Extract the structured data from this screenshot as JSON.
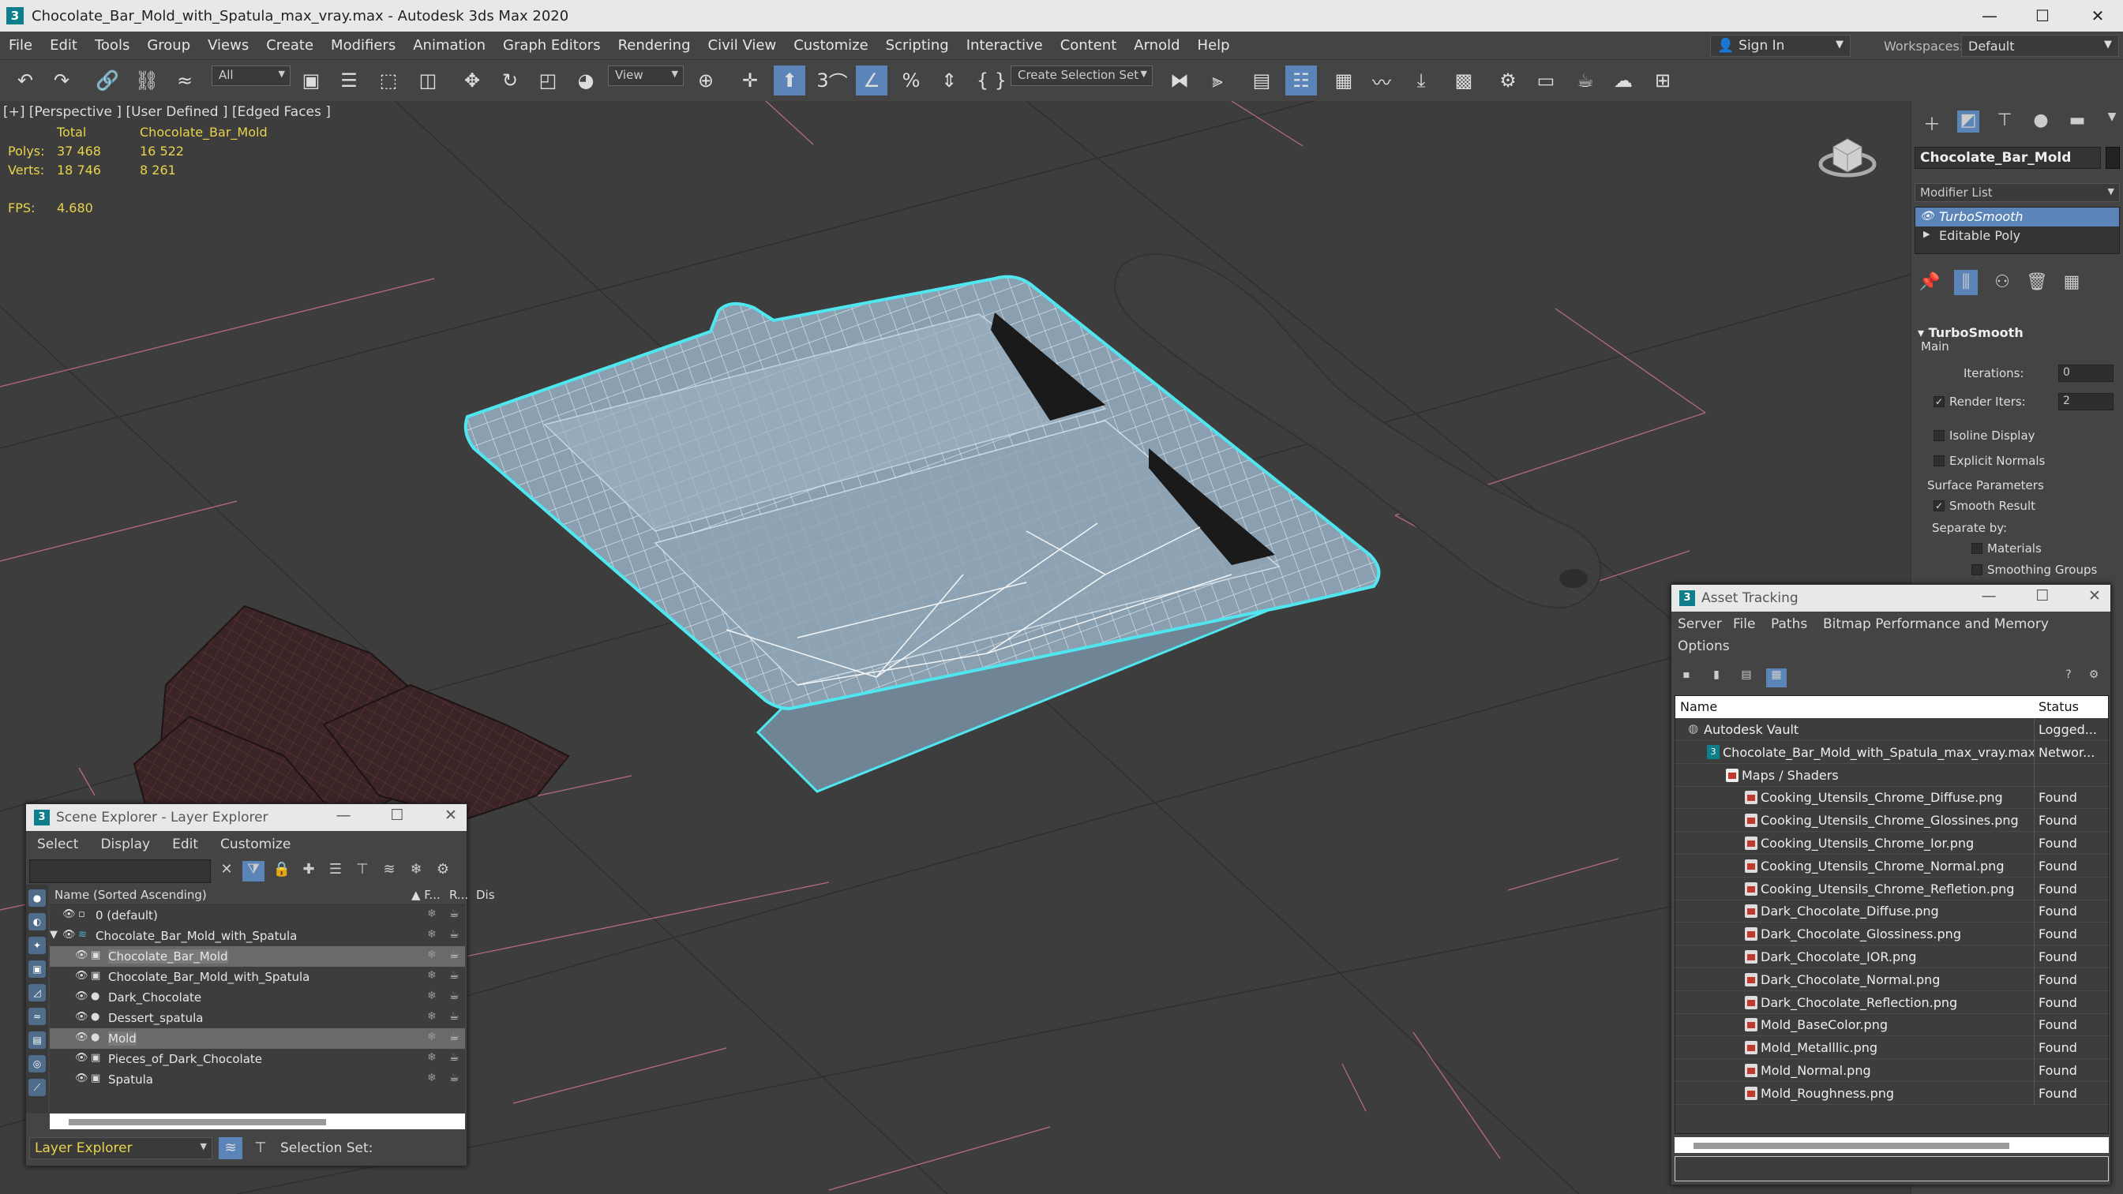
{
  "window": {
    "title": "Chocolate_Bar_Mold_with_Spatula_max_vray.max - Autodesk 3ds Max 2020",
    "app_icon_letter": "3"
  },
  "menubar": {
    "items": [
      "File",
      "Edit",
      "Tools",
      "Group",
      "Views",
      "Create",
      "Modifiers",
      "Animation",
      "Graph Editors",
      "Rendering",
      "Civil View",
      "Customize",
      "Scripting",
      "Interactive",
      "Content",
      "Arnold",
      "Help"
    ],
    "sign_in": "Sign In",
    "workspaces_label": "Workspaces:",
    "workspace_value": "Default"
  },
  "toolbar": {
    "filter_value": "All",
    "coord_value": "View",
    "selection_set": "Create Selection Set",
    "snap_label": "3",
    "accent_color": "#5b84b8"
  },
  "viewport": {
    "label": "[+] [Perspective ] [User Defined ] [Edged Faces ]",
    "stats": {
      "total_label": "Total",
      "object_label": "Chocolate_Bar_Mold",
      "polys_label": "Polys:",
      "polys_total": "37 468",
      "polys_object": "16 522",
      "verts_label": "Verts:",
      "verts_total": "18 746",
      "verts_object": "8 261",
      "fps_label": "FPS:",
      "fps_value": "4.680"
    },
    "selection_color": "#4fe6f0",
    "stat_color": "#e8d34a"
  },
  "command_panel": {
    "object_name": "Chocolate_Bar_Mold",
    "modifier_list": "Modifier List",
    "stack": [
      "TurboSmooth",
      "Editable Poly"
    ],
    "turbosmooth": {
      "header": "TurboSmooth",
      "main_label": "Main",
      "iterations_label": "Iterations:",
      "iterations_value": "0",
      "render_iters_label": "Render Iters:",
      "render_iters_value": "2",
      "render_iters_checked": true,
      "isoline_label": "Isoline Display",
      "explicit_normals_label": "Explicit Normals",
      "surface_params_label": "Surface Parameters",
      "smooth_result_label": "Smooth Result",
      "smooth_result_checked": true,
      "separate_by_label": "Separate by:",
      "materials_label": "Materials",
      "smoothing_groups_label": "Smoothing Groups"
    }
  },
  "scene_explorer": {
    "title": "Scene Explorer - Layer Explorer",
    "menu": [
      "Select",
      "Display",
      "Edit",
      "Customize"
    ],
    "columns": {
      "name": "Name (Sorted Ascending)",
      "frozen": "▲ F...",
      "render": "R...",
      "display": "Dis"
    },
    "rows": [
      {
        "label": "0 (default)",
        "indent": 0,
        "type": "layer",
        "selected": false
      },
      {
        "label": "Chocolate_Bar_Mold_with_Spatula",
        "indent": 0,
        "type": "layer-open",
        "selected": false
      },
      {
        "label": "Chocolate_Bar_Mold",
        "indent": 1,
        "type": "object",
        "selected": true
      },
      {
        "label": "Chocolate_Bar_Mold_with_Spatula",
        "indent": 1,
        "type": "object",
        "selected": false
      },
      {
        "label": "Dark_Chocolate",
        "indent": 1,
        "type": "sphere",
        "selected": false
      },
      {
        "label": "Dessert_spatula",
        "indent": 1,
        "type": "sphere",
        "selected": false
      },
      {
        "label": "Mold",
        "indent": 1,
        "type": "sphere",
        "selected": true
      },
      {
        "label": "Pieces_of_Dark_Chocolate",
        "indent": 1,
        "type": "object",
        "selected": false
      },
      {
        "label": "Spatula",
        "indent": 1,
        "type": "object",
        "selected": false
      }
    ],
    "layer_dropdown": "Layer Explorer",
    "selection_set_label": "Selection Set:"
  },
  "asset_tracking": {
    "title": "Asset Tracking",
    "menu": [
      "Server",
      "File",
      "Paths",
      "Bitmap Performance and Memory",
      "Options"
    ],
    "columns": {
      "name": "Name",
      "status": "Status"
    },
    "rows": [
      {
        "name": "Autodesk Vault",
        "status": "Logged...",
        "indent": 0,
        "icon": "vault"
      },
      {
        "name": "Chocolate_Bar_Mold_with_Spatula_max_vray.max",
        "status": "Networ...",
        "indent": 1,
        "icon": "max"
      },
      {
        "name": "Maps / Shaders",
        "status": "",
        "indent": 2,
        "icon": "folder"
      },
      {
        "name": "Cooking_Utensils_Chrome_Diffuse.png",
        "status": "Found",
        "indent": 3,
        "icon": "image"
      },
      {
        "name": "Cooking_Utensils_Chrome_Glossines.png",
        "status": "Found",
        "indent": 3,
        "icon": "image"
      },
      {
        "name": "Cooking_Utensils_Chrome_Ior.png",
        "status": "Found",
        "indent": 3,
        "icon": "image"
      },
      {
        "name": "Cooking_Utensils_Chrome_Normal.png",
        "status": "Found",
        "indent": 3,
        "icon": "image"
      },
      {
        "name": "Cooking_Utensils_Chrome_Refletion.png",
        "status": "Found",
        "indent": 3,
        "icon": "image"
      },
      {
        "name": "Dark_Chocolate_Diffuse.png",
        "status": "Found",
        "indent": 3,
        "icon": "image"
      },
      {
        "name": "Dark_Chocolate_Glossiness.png",
        "status": "Found",
        "indent": 3,
        "icon": "image"
      },
      {
        "name": "Dark_Chocolate_IOR.png",
        "status": "Found",
        "indent": 3,
        "icon": "image"
      },
      {
        "name": "Dark_Chocolate_Normal.png",
        "status": "Found",
        "indent": 3,
        "icon": "image"
      },
      {
        "name": "Dark_Chocolate_Reflection.png",
        "status": "Found",
        "indent": 3,
        "icon": "image"
      },
      {
        "name": "Mold_BaseColor.png",
        "status": "Found",
        "indent": 3,
        "icon": "image"
      },
      {
        "name": "Mold_Metalllic.png",
        "status": "Found",
        "indent": 3,
        "icon": "image"
      },
      {
        "name": "Mold_Normal.png",
        "status": "Found",
        "indent": 3,
        "icon": "image"
      },
      {
        "name": "Mold_Roughness.png",
        "status": "Found",
        "indent": 3,
        "icon": "image"
      }
    ]
  }
}
